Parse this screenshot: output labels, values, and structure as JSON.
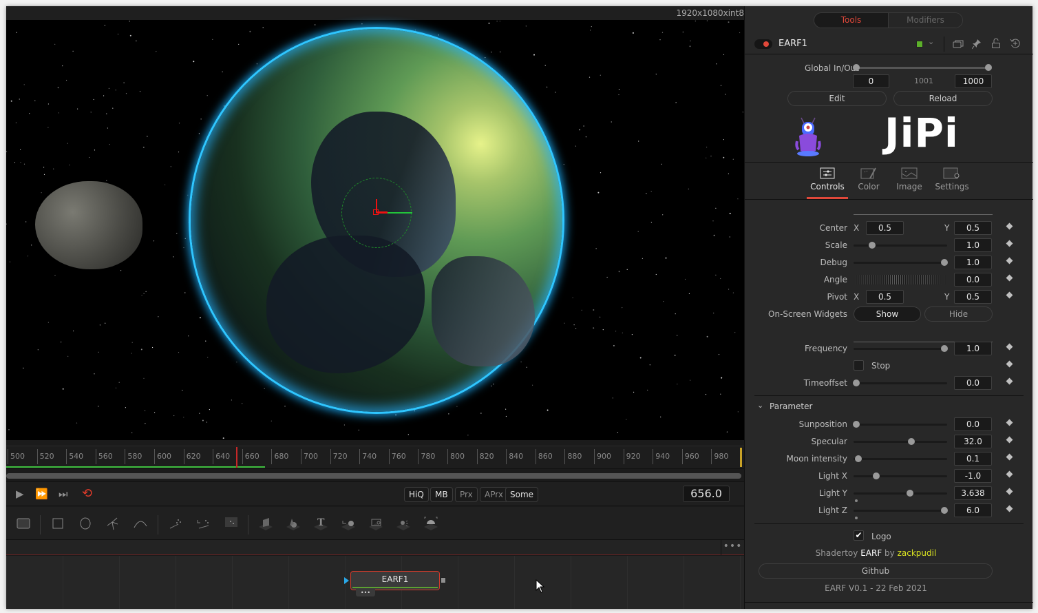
{
  "viewer": {
    "resolution_label": "1920x1080xint8"
  },
  "timeline": {
    "ticks": [
      "500",
      "520",
      "540",
      "560",
      "580",
      "600",
      "620",
      "640",
      "660",
      "680",
      "700",
      "720",
      "740",
      "760",
      "780",
      "800",
      "820",
      "840",
      "860",
      "880",
      "900",
      "920",
      "940",
      "960",
      "980"
    ],
    "current_frame": "656.0"
  },
  "transport": {
    "play_icon": "▶",
    "fast_forward_icon": "⏩",
    "skip_end_icon": "⏭",
    "loop_icon": "⟲",
    "quality_buttons": [
      {
        "label": "HiQ",
        "active": true
      },
      {
        "label": "MB",
        "active": true
      },
      {
        "label": "Prx",
        "active": false
      },
      {
        "label": "APrx",
        "active": false
      },
      {
        "label": "Some",
        "active": true
      }
    ]
  },
  "toolbar": {
    "tools": [
      "background",
      "rectangle-mask",
      "ellipse-mask",
      "polygon-mask",
      "bspline-mask",
      "particle-emitter",
      "particle-render-source",
      "particle-render",
      "image-plane-3d",
      "shape-3d",
      "text-3d",
      "merge-3d",
      "camera-3d",
      "spotlight-3d",
      "renderer-3d"
    ]
  },
  "node_editor": {
    "more_label": "•••",
    "node_label": "EARF1",
    "node_ports": "•••"
  },
  "inspector": {
    "tabs": {
      "tools": "Tools",
      "modifiers": "Modifiers"
    },
    "tool_name": "EARF1",
    "tool_color": "#5cb02a",
    "header_icons": {
      "chevron": "⌄",
      "versions": "⧉",
      "pin": "📌",
      "lock": "🔓",
      "reset": "⟲"
    },
    "global_inout": {
      "label": "Global In/Out",
      "in": "0",
      "duration": "1001",
      "out": "1000"
    },
    "edit_label": "Edit",
    "reload_label": "Reload",
    "logo_text": "JiPi",
    "sub_tabs": [
      {
        "label": "Controls",
        "active": true
      },
      {
        "label": "Color",
        "active": false
      },
      {
        "label": "Image",
        "active": false
      },
      {
        "label": "Settings",
        "active": false
      }
    ],
    "controls": {
      "center": {
        "label": "Center",
        "x_label": "X",
        "x": "0.5",
        "y_label": "Y",
        "y": "0.5"
      },
      "scale": {
        "label": "Scale",
        "value": "1.0",
        "slider": 0.2
      },
      "debug": {
        "label": "Debug",
        "value": "1.0",
        "slider": 0.97
      },
      "angle": {
        "label": "Angle",
        "value": "0.0"
      },
      "pivot": {
        "label": "Pivot",
        "x_label": "X",
        "x": "0.5",
        "y_label": "Y",
        "y": "0.5"
      },
      "widgets": {
        "label": "On-Screen Widgets",
        "show": "Show",
        "hide": "Hide"
      },
      "frequency": {
        "label": "Frequency",
        "value": "1.0",
        "slider": 0.97
      },
      "stop": {
        "label": "Stop",
        "checked": false
      },
      "timeoffset": {
        "label": "Timeoffset",
        "value": "0.0",
        "slider": 0.03
      }
    },
    "parameter_section": {
      "title": "Parameter",
      "rows": [
        {
          "label": "Sunposition",
          "value": "0.0",
          "slider": 0.03
        },
        {
          "label": "Specular",
          "value": "32.0",
          "slider": 0.62
        },
        {
          "label": "Moon intensity",
          "value": "0.1",
          "slider": 0.05
        },
        {
          "label": "Light X",
          "value": "-1.0",
          "slider": 0.24
        },
        {
          "label": "Light Y",
          "value": "3.638",
          "slider": 0.6
        },
        {
          "label": "Light Z",
          "value": "6.0",
          "slider": 0.97
        }
      ]
    },
    "logo_checkbox": {
      "label": "Logo",
      "checked": true
    },
    "credit": {
      "prefix": "Shadertoy",
      "name": "EARF",
      "by": "by",
      "author": "zackpudil"
    },
    "github_label": "Github",
    "version": "EARF V0.1 - 22 Feb 2021"
  }
}
